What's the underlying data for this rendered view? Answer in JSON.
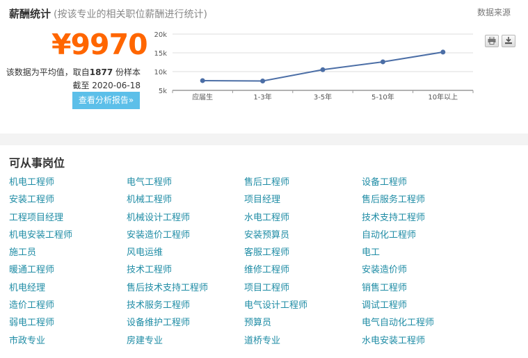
{
  "salary": {
    "title": "薪酬统计",
    "subtitle": "(按该专业的相关职位薪酬进行统计)",
    "source_link": "数据来源",
    "average": "¥9970",
    "sample_prefix": "该数据为平均值，取自",
    "sample_count": "1877",
    "sample_suffix": " 份样本",
    "date_text": "截至 2020-06-18",
    "report_button": "查看分析报告»",
    "print_icon": "printer-icon",
    "download_icon": "download-icon"
  },
  "chart_data": {
    "type": "line",
    "categories": [
      "应届生",
      "1-3年",
      "3-5年",
      "5-10年",
      "10年以上"
    ],
    "values": [
      7600,
      7500,
      10500,
      12600,
      15200
    ],
    "y_ticks": [
      "5k",
      "10k",
      "15k",
      "20k"
    ],
    "ylim": [
      5000,
      20000
    ],
    "grid": true,
    "line_color": "#4b6ea6"
  },
  "jobs": {
    "title": "可从事岗位",
    "items": [
      "机电工程师",
      "电气工程师",
      "售后工程师",
      "设备工程师",
      "安装工程师",
      "机械工程师",
      "项目经理",
      "售后服务工程师",
      "工程项目经理",
      "机械设计工程师",
      "水电工程师",
      "技术支持工程师",
      "机电安装工程师",
      "安装造价工程师",
      "安装预算员",
      "自动化工程师",
      "施工员",
      "风电运维",
      "客服工程师",
      "电工",
      "暖通工程师",
      "技术工程师",
      "维修工程师",
      "安装造价师",
      "机电经理",
      "售后技术支持工程师",
      "项目工程师",
      "销售工程师",
      "造价工程师",
      "技术服务工程师",
      "电气设计工程师",
      "调试工程师",
      "弱电工程师",
      "设备维护工程师",
      "预算员",
      "电气自动化工程师",
      "市政专业",
      "房建专业",
      "道桥专业",
      "水电安装工程师"
    ]
  }
}
